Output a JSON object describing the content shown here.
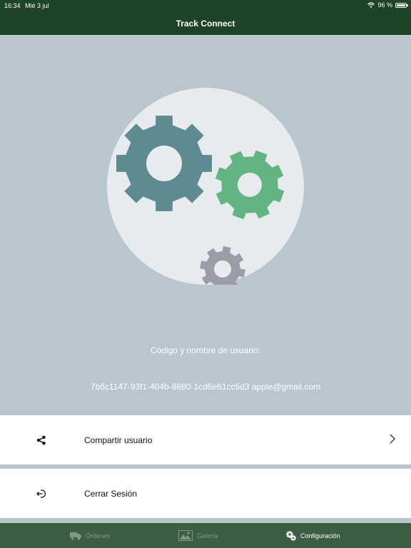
{
  "status_bar": {
    "time": "16:34",
    "date": "Mié 3 jul",
    "battery": "96 %",
    "battery_level_percent": 96
  },
  "nav": {
    "title": "Track Connect"
  },
  "hero": {
    "code_label": "Código y nombre de usuario:",
    "code_value": "7b6c1147-93f1-404b-8680-1cd6e61cc5d3  apple@gmail.com"
  },
  "menu": {
    "share": {
      "label": "Compartir usuario",
      "icon": "share-icon"
    },
    "logout": {
      "label": "Cerrar Sesión",
      "icon": "logout-icon"
    }
  },
  "tabs": [
    {
      "label": "Órdenes",
      "icon": "truck-icon",
      "active": false
    },
    {
      "label": "Galería",
      "icon": "image-icon",
      "active": false
    },
    {
      "label": "Configuración",
      "icon": "gears-icon",
      "active": true
    }
  ],
  "colors": {
    "header": "#1e4327",
    "tab_bar": "#3d5e43",
    "hero_bg": "#b9c6ce",
    "gear_large": "#5e8a92",
    "gear_medium": "#63b483",
    "gear_small": "#9c9ca8"
  }
}
